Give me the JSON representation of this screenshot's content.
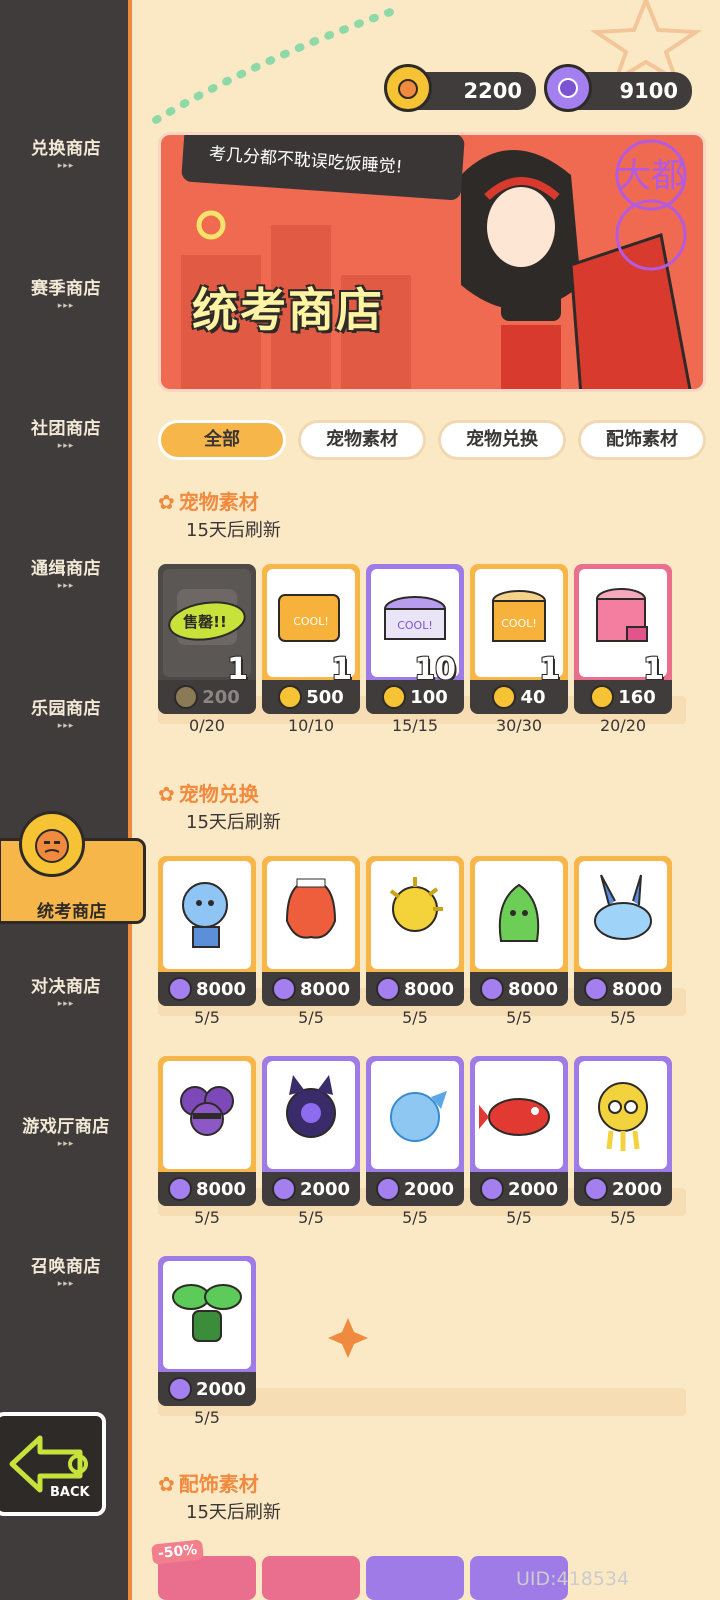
{
  "sidebar": {
    "items": [
      {
        "label": "兑换商店",
        "dots": "▸▸▸"
      },
      {
        "label": "赛季商店",
        "dots": "▸▸▸"
      },
      {
        "label": "社团商店",
        "dots": "▸▸▸"
      },
      {
        "label": "通缉商店",
        "dots": "▸▸▸"
      },
      {
        "label": "乐园商店",
        "dots": "▸▸▸"
      },
      {
        "label": "统考商店"
      },
      {
        "label": "对决商店",
        "dots": "▸▸▸"
      },
      {
        "label": "游戏厅商店",
        "dots": "▸▸▸"
      },
      {
        "label": "召唤商店",
        "dots": "▸▸▸"
      }
    ],
    "back_label": "BACK"
  },
  "currency": {
    "coin_value": "2200",
    "gem_value": "9100"
  },
  "banner": {
    "speech": "考几分都不耽误吃饭睡觉!",
    "title": "统考商店",
    "stamp": "大都"
  },
  "tabs": [
    "全部",
    "宠物素材",
    "宠物兑换",
    "配饰素材"
  ],
  "sections": [
    {
      "title": "宠物素材",
      "refresh": "15天后刷新",
      "items": [
        {
          "qty": "1",
          "price": "200",
          "stock": "0/20",
          "sold": "售罄!!"
        },
        {
          "qty": "1",
          "price": "500",
          "stock": "10/10"
        },
        {
          "qty": "10",
          "price": "100",
          "stock": "15/15"
        },
        {
          "qty": "1",
          "price": "40",
          "stock": "30/30"
        },
        {
          "qty": "1",
          "price": "160",
          "stock": "20/20"
        }
      ]
    },
    {
      "title": "宠物兑换",
      "refresh": "15天后刷新",
      "items": [
        {
          "price": "8000",
          "stock": "5/5"
        },
        {
          "price": "8000",
          "stock": "5/5"
        },
        {
          "price": "8000",
          "stock": "5/5"
        },
        {
          "price": "8000",
          "stock": "5/5"
        },
        {
          "price": "8000",
          "stock": "5/5"
        },
        {
          "price": "8000",
          "stock": "5/5"
        },
        {
          "price": "2000",
          "stock": "5/5"
        },
        {
          "price": "2000",
          "stock": "5/5"
        },
        {
          "price": "2000",
          "stock": "5/5"
        },
        {
          "price": "2000",
          "stock": "5/5"
        },
        {
          "price": "2000",
          "stock": "5/5"
        }
      ]
    },
    {
      "title": "配饰素材",
      "refresh": "15天后刷新",
      "discount": "-50%"
    }
  ],
  "uid": "UID:418534",
  "colors": {
    "accent_orange": "#f08a3e",
    "sidebar_bg": "#3f3c3b",
    "page_bg": "#fbe9c6"
  }
}
